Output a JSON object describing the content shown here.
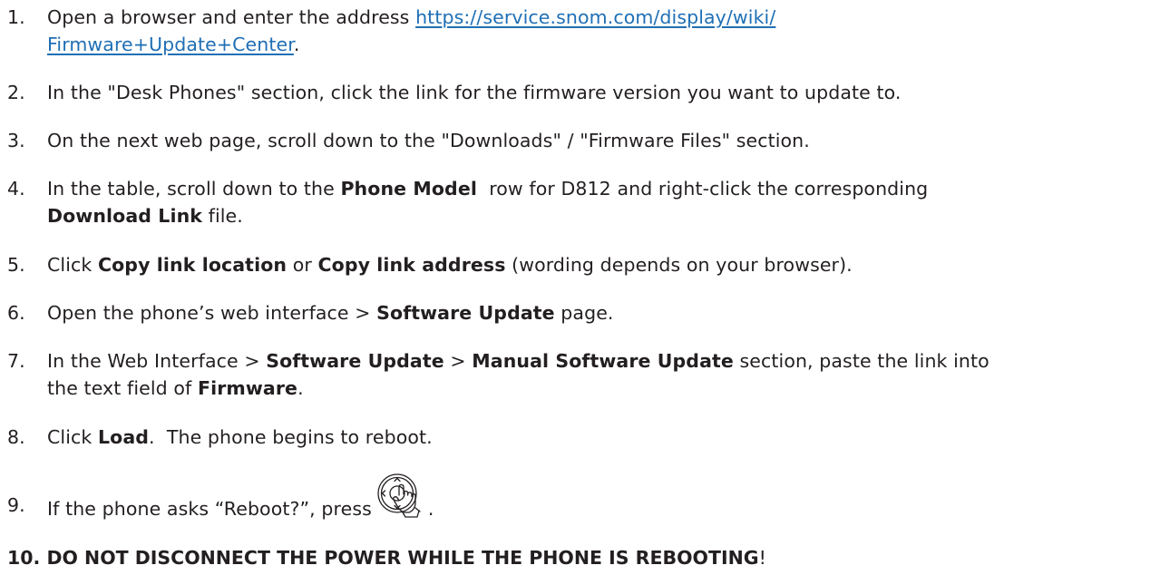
{
  "steps": [
    {
      "num": "1.",
      "text": "Open a browser and enter the address ",
      "link_line1": "https://service.snom.com/display/wiki/",
      "link_line2": "Firmware+Update+Center",
      "after_link": "."
    },
    {
      "num": "2.",
      "text": "In the \"Desk Phones\" section, click the link for the firmware version you want to update to."
    },
    {
      "num": "3.",
      "text": "On the next web page, scroll down to the \"Downloads\" / \"Firmware Files\" section."
    },
    {
      "num": "4.",
      "pre": "In the table, scroll down to the ",
      "bold1": "Phone Model",
      "mid": "  row for D812 and right-click the corresponding",
      "bold2": "Download Link",
      "post": " file."
    },
    {
      "num": "5.",
      "pre": "Click ",
      "bold1": "Copy link location",
      "mid": " or ",
      "bold2": "Copy link address",
      "post": " (wording depends on your browser)."
    },
    {
      "num": "6.",
      "pre": "Open the phone’s web interface > ",
      "bold1": "Software Update",
      "post": " page."
    },
    {
      "num": "7.",
      "pre": "In the Web Interface > ",
      "bold1": "Software Update",
      "mid": " > ",
      "bold2": "Manual Software Update",
      "mid2": " section, paste the link into",
      "line2_pre": "the text field of ",
      "bold3": "Firmware",
      "post": "."
    },
    {
      "num": "8.",
      "pre": "Click ",
      "bold1": "Load",
      "post": ".  The phone begins to reboot."
    },
    {
      "num": "9.",
      "pre": "If the phone asks “Reboot?”, press",
      "icon": "navigation-key-press-icon",
      "post": "."
    }
  ],
  "final": {
    "text": "10. DO NOT DISCONNECT THE POWER WHILE THE PHONE IS REBOOTING",
    "bang": "!"
  },
  "colors": {
    "text": "#231f20",
    "link": "#1f6fb5"
  }
}
